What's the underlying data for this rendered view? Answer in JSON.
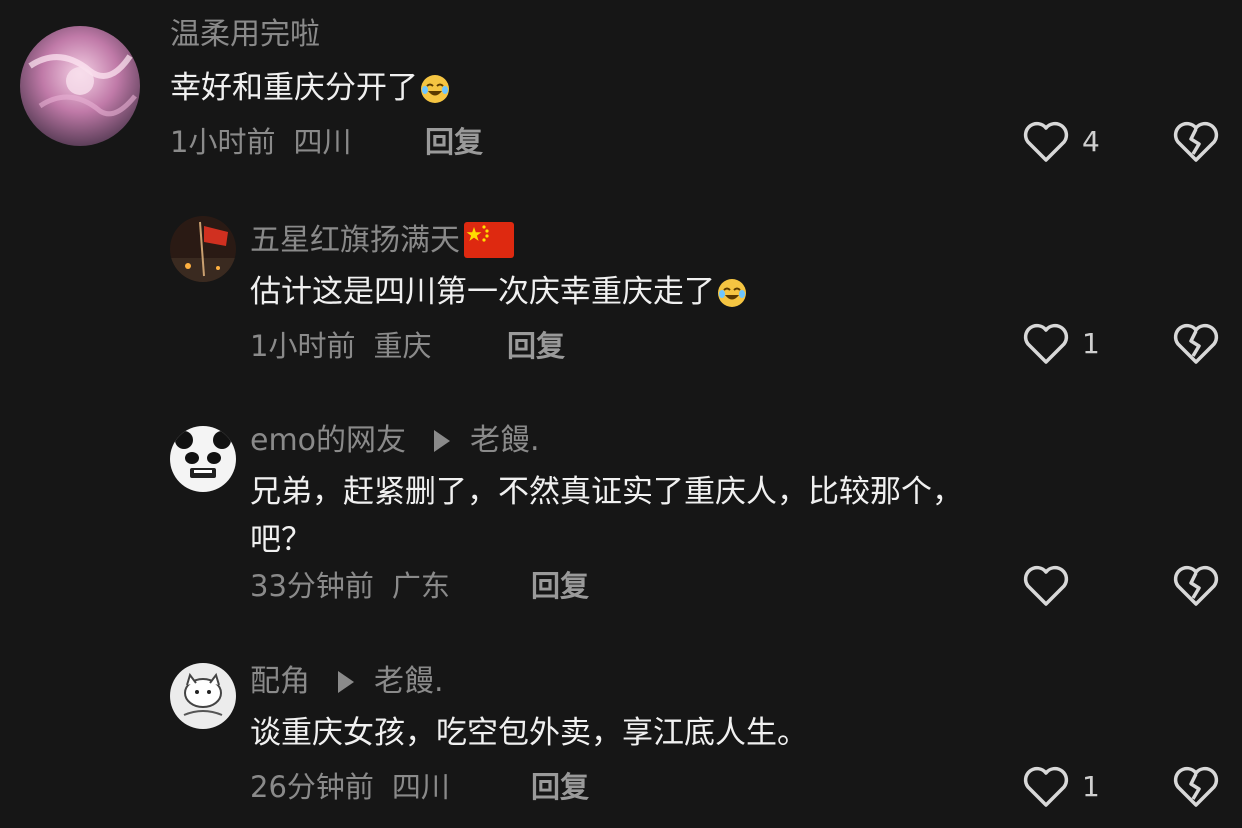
{
  "comments": [
    {
      "username": "温柔用完啦",
      "text": "幸好和重庆分开了",
      "emoji": "laugh-cry-emoji",
      "time": "1小时前",
      "location": "四川",
      "reply_label": "回复",
      "like_count": "4"
    },
    {
      "username": "五星红旗扬满天",
      "username_flag": "china-flag-icon",
      "text": "估计这是四川第一次庆幸重庆走了",
      "emoji": "laugh-cry-emoji",
      "time": "1小时前",
      "location": "重庆",
      "reply_label": "回复",
      "like_count": "1"
    },
    {
      "username": "emo的网友",
      "reply_to": "老饅.",
      "text_line1": "兄弟，赶紧删了，不然真证实了重庆人，比较那个，",
      "text_line2": "吧？",
      "time": "33分钟前",
      "location": "广东",
      "reply_label": "回复",
      "like_count": ""
    },
    {
      "username": "配角",
      "reply_to": "老饅.",
      "text": "谈重庆女孩，吃空包外卖，享江底人生。",
      "time": "26分钟前",
      "location": "四川",
      "reply_label": "回复",
      "like_count": "1"
    }
  ],
  "colors": {
    "background": "#161616",
    "primary_text": "#f0f0f0",
    "secondary_text": "#8a8a8a"
  }
}
